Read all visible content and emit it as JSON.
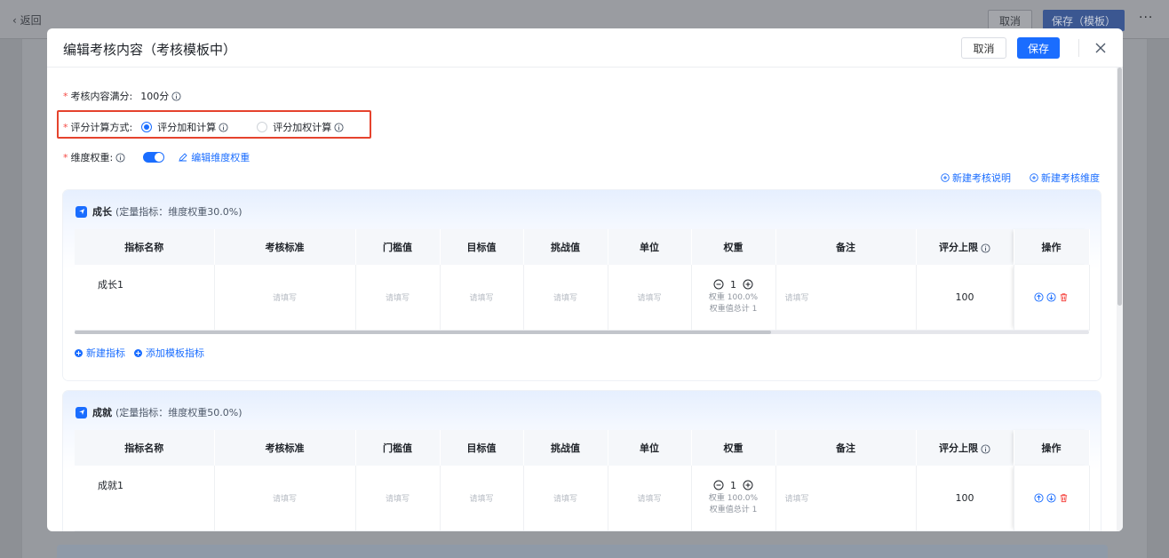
{
  "background": {
    "back_label": "返回",
    "cancel_label": "取消",
    "save_label": "保存（模板）",
    "more_label": "···"
  },
  "modal": {
    "title": "编辑考核内容（考核模板中）",
    "cancel_label": "取消",
    "save_label": "保存"
  },
  "form": {
    "full_score_label": "考核内容满分:",
    "full_score_value": "100分",
    "calc_method_label": "评分计算方式:",
    "calc_options": [
      {
        "label": "评分加和计算",
        "selected": true
      },
      {
        "label": "评分加权计算",
        "selected": false
      }
    ],
    "dimension_weight_label": "维度权重:",
    "dimension_weight_enabled": true,
    "edit_dimension_weight_label": "编辑维度权重"
  },
  "top_actions": {
    "new_description_label": "新建考核说明",
    "new_dimension_label": "新建考核维度"
  },
  "table_headers": [
    "指标名称",
    "考核标准",
    "门槛值",
    "目标值",
    "挑战值",
    "单位",
    "权重",
    "备注",
    "评分上限",
    "操作"
  ],
  "placeholder": "请填写",
  "sections": [
    {
      "name": "成长",
      "meta": "(定量指标：维度权重30.0%)",
      "rows": [
        {
          "name": "成长1",
          "weight": "1",
          "weight_pct": "权重 100.0%",
          "weight_total": "权重值总计 1",
          "score_cap": "100"
        }
      ],
      "new_indicator_label": "新建指标",
      "add_template_label": "添加模板指标"
    },
    {
      "name": "成就",
      "meta": "(定量指标：维度权重50.0%)",
      "rows": [
        {
          "name": "成就1",
          "weight": "1",
          "weight_pct": "权重 100.0%",
          "weight_total": "权重值总计 1",
          "score_cap": "100"
        }
      ]
    }
  ],
  "colors": {
    "primary": "#1a6dff",
    "required": "#f54a45",
    "highlight": "#e5432d",
    "delete": "#f54a45"
  }
}
